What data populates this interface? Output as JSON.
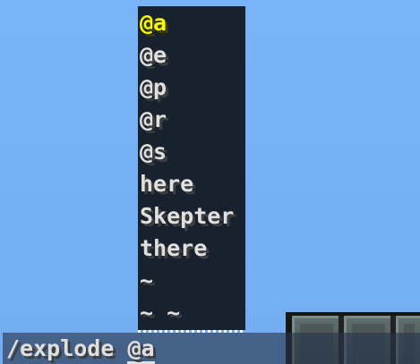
{
  "suggestions": {
    "items": [
      {
        "label": "@a",
        "selected": true
      },
      {
        "label": "@e",
        "selected": false
      },
      {
        "label": "@p",
        "selected": false
      },
      {
        "label": "@r",
        "selected": false
      },
      {
        "label": "@s",
        "selected": false
      },
      {
        "label": "here",
        "selected": false
      },
      {
        "label": "Skepter",
        "selected": false
      },
      {
        "label": "there",
        "selected": false
      },
      {
        "label": "~",
        "selected": false
      },
      {
        "label": "~ ~",
        "selected": false
      }
    ]
  },
  "chat": {
    "command": "/explode ",
    "argument": "@a"
  },
  "colors": {
    "sky": "#79b3f7",
    "popup_bg": "#18222e",
    "selected_text": "#fcfc00",
    "text": "#e0e0e0"
  }
}
